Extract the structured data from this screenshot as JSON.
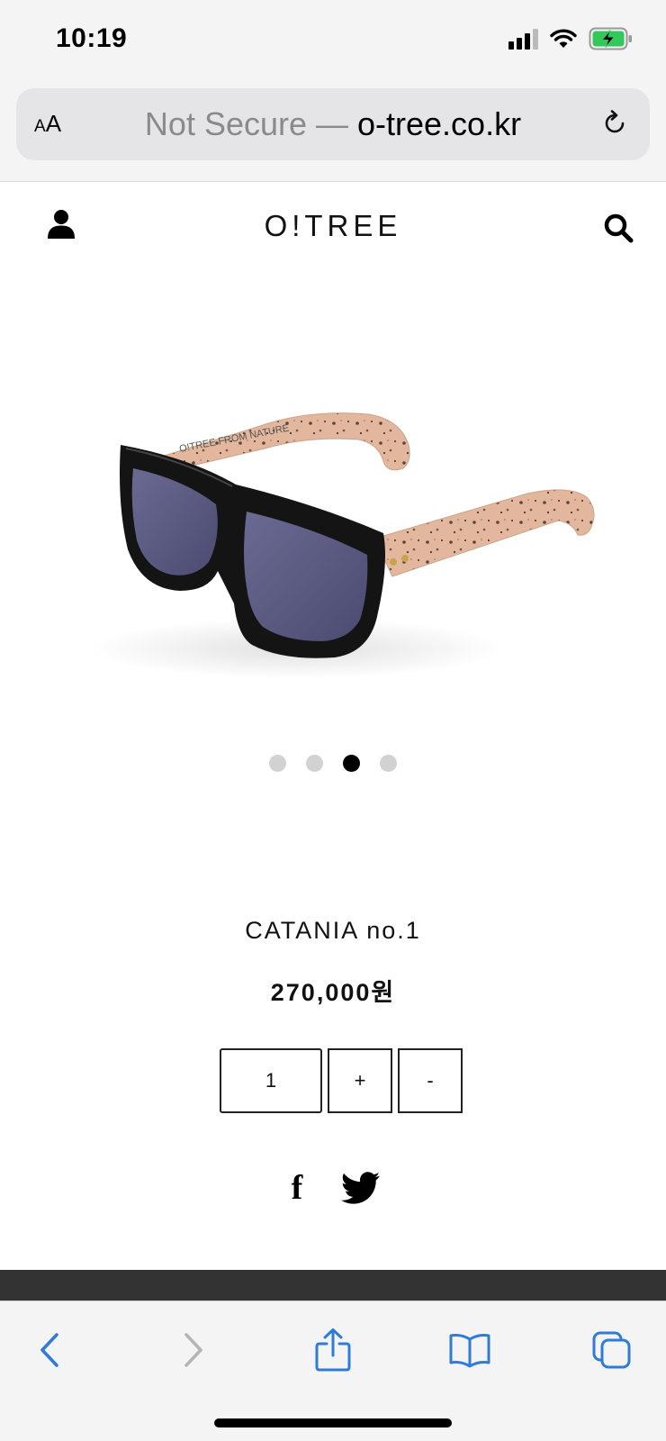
{
  "status_bar": {
    "time": "10:19"
  },
  "browser": {
    "aa_small": "A",
    "aa_large": "A",
    "url_prefix": "Not Secure — ",
    "url_domain": "o-tree.co.kr"
  },
  "site": {
    "logo": "O!TREE"
  },
  "carousel": {
    "dots": 4,
    "active_index": 2
  },
  "product": {
    "name": "CATANIA no.1",
    "price": "270,000원",
    "frame_print": "O!TREE  FROM NATURE"
  },
  "quantity": {
    "value": "1",
    "plus_label": "+",
    "minus_label": "-"
  },
  "social": {
    "facebook_label": "f"
  },
  "colors": {
    "chrome_bg": "#f4f4f4",
    "urlbar_bg": "#e5e5e8",
    "ios_blue": "#2f7bd6",
    "battery_green": "#34c759",
    "footer_strip": "#333333"
  },
  "icons": {
    "user": "user-icon",
    "search": "search-icon",
    "reload": "reload-icon",
    "back": "back-icon",
    "forward": "forward-icon",
    "share": "share-icon",
    "bookmarks": "bookmarks-icon",
    "tabs": "tabs-icon",
    "twitter": "twitter-icon"
  }
}
